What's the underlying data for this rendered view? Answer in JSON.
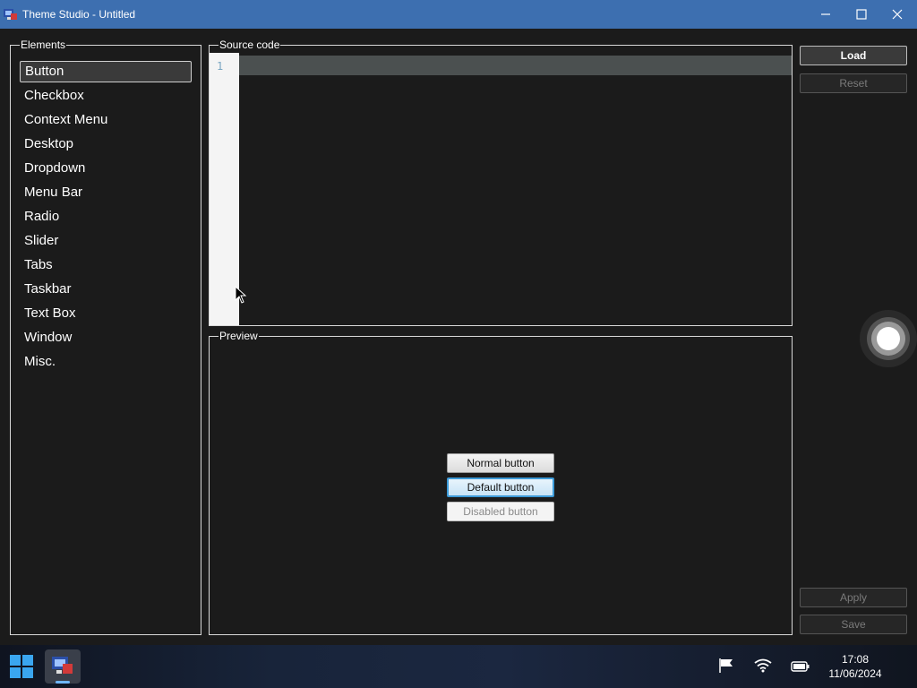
{
  "window": {
    "title": "Theme Studio - Untitled"
  },
  "elements_panel": {
    "label": "Elements",
    "items": [
      {
        "label": "Button",
        "selected": true
      },
      {
        "label": "Checkbox"
      },
      {
        "label": "Context Menu"
      },
      {
        "label": "Desktop"
      },
      {
        "label": "Dropdown"
      },
      {
        "label": "Menu Bar"
      },
      {
        "label": "Radio"
      },
      {
        "label": "Slider"
      },
      {
        "label": "Tabs"
      },
      {
        "label": "Taskbar"
      },
      {
        "label": "Text Box"
      },
      {
        "label": "Window"
      },
      {
        "label": "Misc."
      }
    ]
  },
  "source_panel": {
    "label": "Source code",
    "line_number": "1",
    "content": ""
  },
  "preview_panel": {
    "label": "Preview",
    "normal_button": "Normal button",
    "default_button": "Default button",
    "disabled_button": "Disabled button"
  },
  "actions": {
    "load": "Load",
    "reset": "Reset",
    "apply": "Apply",
    "save": "Save"
  },
  "taskbar": {
    "time": "17:08",
    "date": "11/06/2024"
  },
  "colors": {
    "titlebar": "#3d6fb0",
    "background": "#1b1b1b",
    "default_button_border": "#3c9ad8"
  }
}
